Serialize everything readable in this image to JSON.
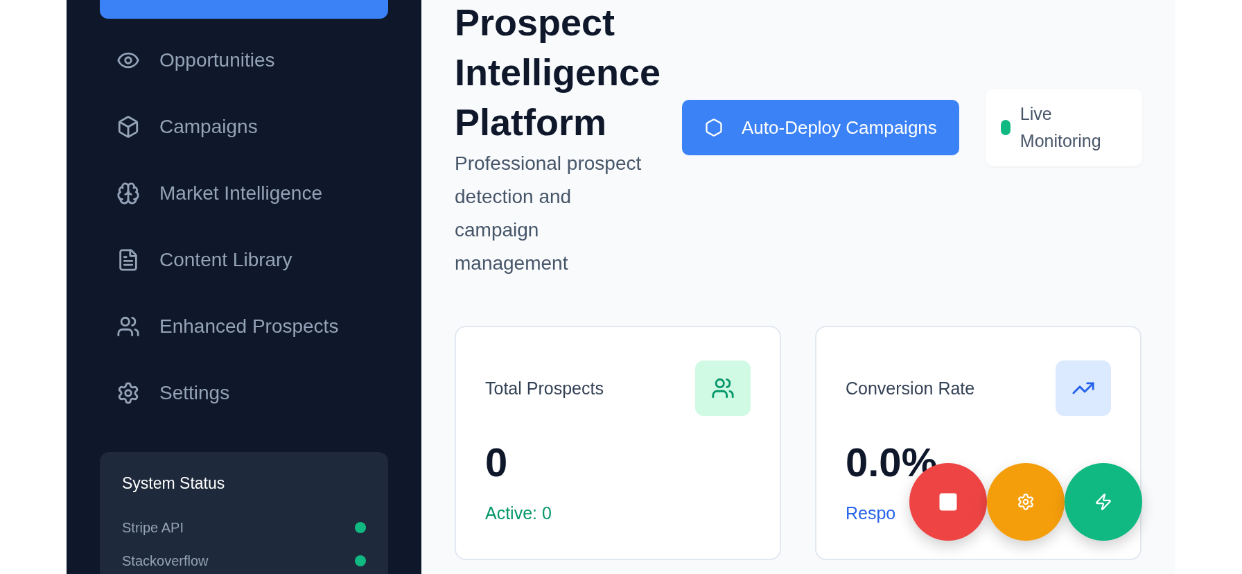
{
  "sidebar": {
    "nav_items": [
      {
        "kind": "active",
        "selected": true
      },
      {
        "kind": "eye",
        "label": "Opportunities",
        "selected": false
      },
      {
        "kind": "box",
        "label": "Campaigns",
        "selected": false
      },
      {
        "kind": "brain",
        "label": "Market Intelligence",
        "selected": false
      },
      {
        "kind": "file",
        "label": "Content Library",
        "selected": false
      },
      {
        "kind": "users",
        "label": "Enhanced Prospects",
        "selected": false
      },
      {
        "kind": "gear",
        "label": "Settings",
        "selected": false
      }
    ],
    "system_status": {
      "title": "System Status",
      "services": [
        {
          "name": "Stripe API",
          "color": "#10b981"
        },
        {
          "name": "Stackoverflow",
          "color": "#10b981"
        }
      ]
    }
  },
  "header": {
    "title": "Prospect Intelligence Platform",
    "subtitle": "Professional prospect detection and campaign management",
    "deploy_button": "Auto-Deploy Campaigns",
    "live_status": {
      "label": "Live Monitoring",
      "color": "#10b981"
    }
  },
  "stats": [
    {
      "kind": "users",
      "label": "Total Prospects",
      "value": "0",
      "note": "Active: 0",
      "color": "#059669"
    },
    {
      "kind": "trend",
      "label": "Conversion Rate",
      "value": "0.0%",
      "note": "Respo",
      "color": "#2563eb"
    }
  ],
  "floating_buttons": [
    {
      "kind": "stop",
      "color": "#ef4444"
    },
    {
      "kind": "gear",
      "color": "#f59e0b"
    },
    {
      "kind": "bolt",
      "color": "#10b981"
    }
  ]
}
